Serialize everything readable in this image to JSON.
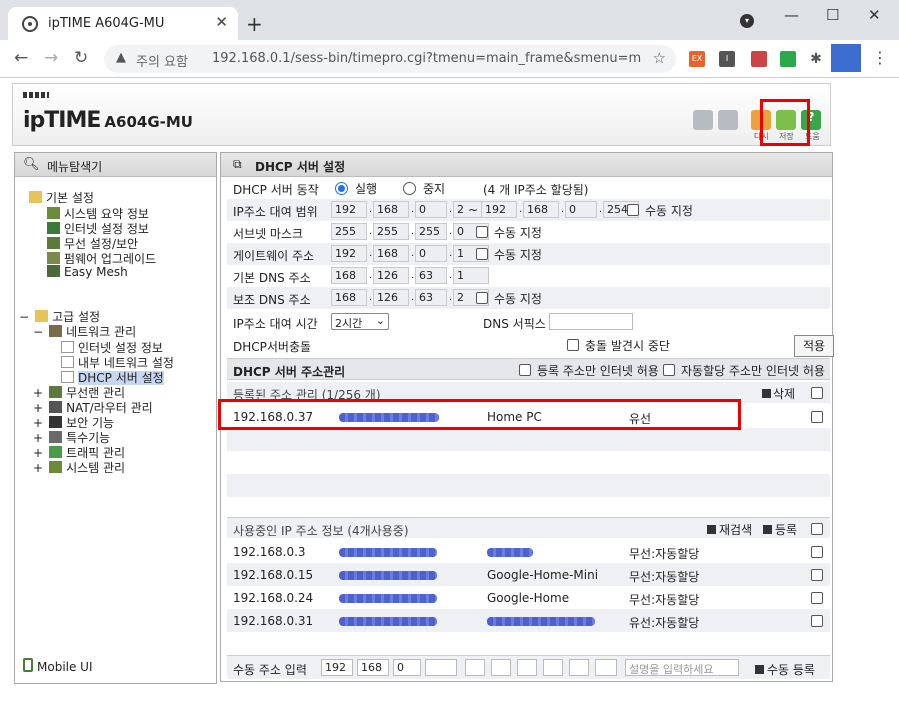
{
  "browser": {
    "tab_title": "ipTIME A604G-MU",
    "security": "주의 요함",
    "url": "192.168.0.1/sess-bin/timepro.cgi?tmenu=main_frame&smenu=main_fr...",
    "ext_labels": [
      "EX",
      "I"
    ]
  },
  "router": {
    "brand": "ipTIME",
    "model": "A604G-MU",
    "icons": [
      {
        "name": "home-icon",
        "color": "#9aa0a6"
      },
      {
        "name": "logout-icon",
        "color": "#9aa0a6"
      },
      {
        "name": "restart-icon",
        "label": "다시",
        "color": "#e8a33c"
      },
      {
        "name": "save-icon",
        "label": "저장",
        "color": "#7cc04b"
      },
      {
        "name": "help-icon",
        "label": "도움",
        "color": "#3aa64a"
      }
    ]
  },
  "nav": {
    "title": "메뉴탐색기",
    "basic": {
      "label": "기본 설정",
      "items": [
        "시스템 요약 정보",
        "인터넷 설정 정보",
        "무선 설정/보안",
        "펌웨어 업그레이드",
        "Easy Mesh"
      ]
    },
    "advanced": {
      "label": "고급 설정",
      "network": "네트워크 관리",
      "network_items": [
        "인터넷 설정 정보",
        "내부 네트워크 설정",
        "DHCP 서버 설정"
      ],
      "others": [
        "무선랜 관리",
        "NAT/라우터 관리",
        "보안 기능",
        "특수기능",
        "트래픽 관리",
        "시스템 관리"
      ]
    },
    "mobile": "Mobile UI"
  },
  "dhcp": {
    "title": "DHCP 서버 설정",
    "op_label": "DHCP 서버 동작",
    "run": "실행",
    "stop": "중지",
    "assigned": "(4 개 IP주소 할당됨)",
    "range_label": "IP주소 대여 범위",
    "range_start": [
      "192",
      "168",
      "0",
      "2"
    ],
    "tilde": "~",
    "range_end": [
      "192",
      "168",
      "0",
      "254"
    ],
    "manual": "수동 지정",
    "subnet_label": "서브넷 마스크",
    "subnet": [
      "255",
      "255",
      "255",
      "0"
    ],
    "gateway_label": "게이트웨이 주소",
    "gateway": [
      "192",
      "168",
      "0",
      "1"
    ],
    "dns1_label": "기본 DNS 주소",
    "dns1": [
      "168",
      "126",
      "63",
      "1"
    ],
    "dns2_label": "보조 DNS 주소",
    "dns2": [
      "168",
      "126",
      "63",
      "2"
    ],
    "lease_label": "IP주소 대여 시간",
    "lease_value": "2시간",
    "dns_suffix_label": "DNS 서픽스",
    "conflict_label": "DHCP서버충돌",
    "conflict_stop": "충돌 발견시 중단",
    "apply": "적용"
  },
  "addr": {
    "title": "DHCP 서버 주소관리",
    "reg_only": "등록 주소만 인터넷 허용",
    "auto_only": "자동할당 주소만 인터넷 허용",
    "registered_title": "등록된 주소 관리 (1/256 개)",
    "delete": "삭제",
    "registered": [
      {
        "ip": "192.168.0.37",
        "name": "Home PC",
        "type": "유선"
      }
    ],
    "in_use_title": "사용중인 IP 주소 정보 (4개사용중)",
    "rescan": "재검색",
    "register": "등록",
    "in_use": [
      {
        "ip": "192.168.0.3",
        "name": "",
        "type": "무선:자동할당"
      },
      {
        "ip": "192.168.0.15",
        "name": "Google-Home-Mini",
        "type": "무선:자동할당"
      },
      {
        "ip": "192.168.0.24",
        "name": "Google-Home",
        "type": "무선:자동할당"
      },
      {
        "ip": "192.168.0.31",
        "name": "",
        "type": "유선:자동할당"
      }
    ],
    "manual_label": "수동 주소 입력",
    "manual_ip": [
      "192",
      "168",
      "0",
      ""
    ],
    "desc_placeholder": "설명을 입력하세요",
    "manual_register": "수동 등록"
  }
}
